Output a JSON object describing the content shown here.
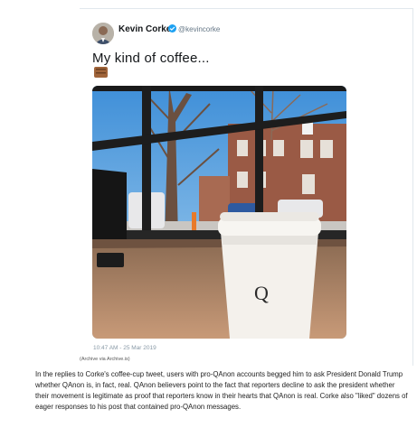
{
  "tweet": {
    "author_name": "Kevin Corke",
    "handle": "@kevincorke",
    "text": "My kind of coffee...",
    "emoji": "coffee-emoji",
    "timestamp": "10:47 AM - 25 Mar 2019",
    "cup_letter": "Q"
  },
  "caption": {
    "archive": "(Archive via Archive.is)"
  },
  "article": {
    "paragraph": "In the replies to Corke's coffee-cup tweet, users with pro-QAnon accounts begged him to ask President Donald Trump whether QAnon is, in fact, real. QAnon believers point to the fact that reporters decline to ask the president whether their movement is legitimate as proof that reporters know in their hearts that QAnon is real. Corke also \"liked\" dozens of eager responses to his post that contained pro-QAnon messages."
  },
  "colors": {
    "verified_blue": "#1da1f2",
    "handle_gray": "#657786"
  }
}
